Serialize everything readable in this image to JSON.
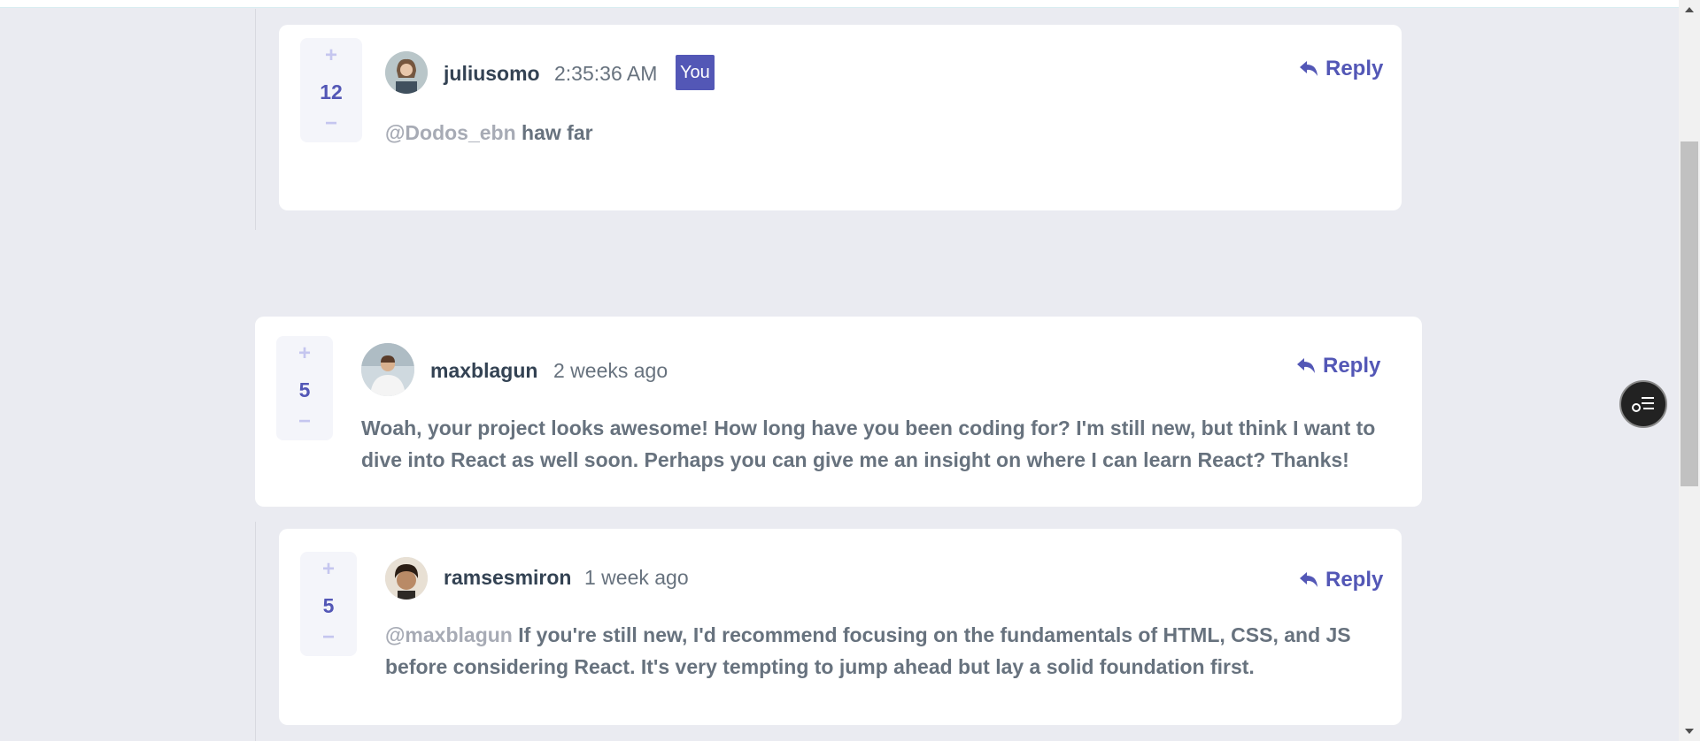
{
  "comments": [
    {
      "score": "12",
      "username": "juliusomo",
      "time": "2:35:36 AM",
      "badge": "You",
      "reply_label": "Reply",
      "mention": "@Dodos_ebn",
      "text": " haw far"
    },
    {
      "score": "5",
      "username": "maxblagun",
      "time": "2 weeks ago",
      "reply_label": "Reply",
      "text": "Woah, your project looks awesome! How long have you been coding for? I'm still new, but think I want to dive into React as well soon. Perhaps you can give me an insight on where I can learn React? Thanks!"
    },
    {
      "score": "5",
      "username": "ramsesmiron",
      "time": "1 week ago",
      "reply_label": "Reply",
      "mention": "@maxblagun",
      "text": " If you're still new, I'd recommend focusing on the fundamentals of HTML, CSS, and JS before considering React. It's very tempting to jump ahead but lay a solid foundation first."
    }
  ],
  "icons": {
    "vote_up": "+",
    "vote_down": "−",
    "reply": "reply-icon",
    "floating": "list-icon"
  },
  "colors": {
    "accent": "#5357b6",
    "background": "#eaebf1",
    "light_accent": "#c5c6ef"
  }
}
